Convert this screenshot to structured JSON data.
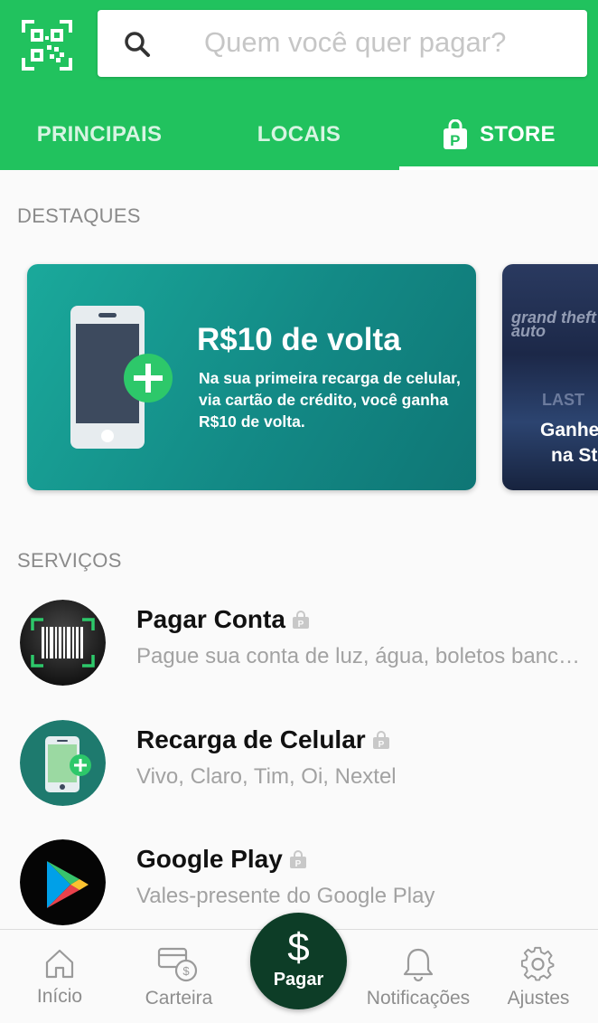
{
  "header": {
    "search_placeholder": "Quem você quer pagar?",
    "qr_icon": "qr-code-scan-icon",
    "accent_color": "#21c25e"
  },
  "tabs": [
    {
      "label": "PRINCIPAIS",
      "active": false
    },
    {
      "label": "LOCAIS",
      "active": false
    },
    {
      "label": "STORE",
      "active": true,
      "icon": "store-bag-icon"
    }
  ],
  "sections": {
    "highlights_title": "DESTAQUES",
    "services_title": "SERVIÇOS"
  },
  "banners": [
    {
      "title": "R$10 de volta",
      "text": "Na sua primeira recarga de celular, via cartão de crédito, você ganha R$10 de volta.",
      "icon": "phone-plus-icon"
    },
    {
      "art_title": "grand theft auto",
      "art_subtitle": "LAST",
      "text_line1": "Ganhe",
      "text_line2": "na St"
    }
  ],
  "services": [
    {
      "title": "Pagar Conta",
      "subtitle": "Pague sua conta de luz, água, boletos bancários",
      "icon": "barcode-scan-icon"
    },
    {
      "title": "Recarga de Celular",
      "subtitle": "Vivo, Claro, Tim, Oi, Nextel",
      "icon": "phone-recharge-icon"
    },
    {
      "title": "Google Play",
      "subtitle": "Vales-presente do Google Play",
      "icon": "google-play-icon"
    }
  ],
  "bottom_nav": {
    "home": "Início",
    "wallet": "Carteira",
    "pay_symbol": "$",
    "pay": "Pagar",
    "notifications": "Notificações",
    "settings": "Ajustes",
    "pay_color": "#0d3d27"
  }
}
